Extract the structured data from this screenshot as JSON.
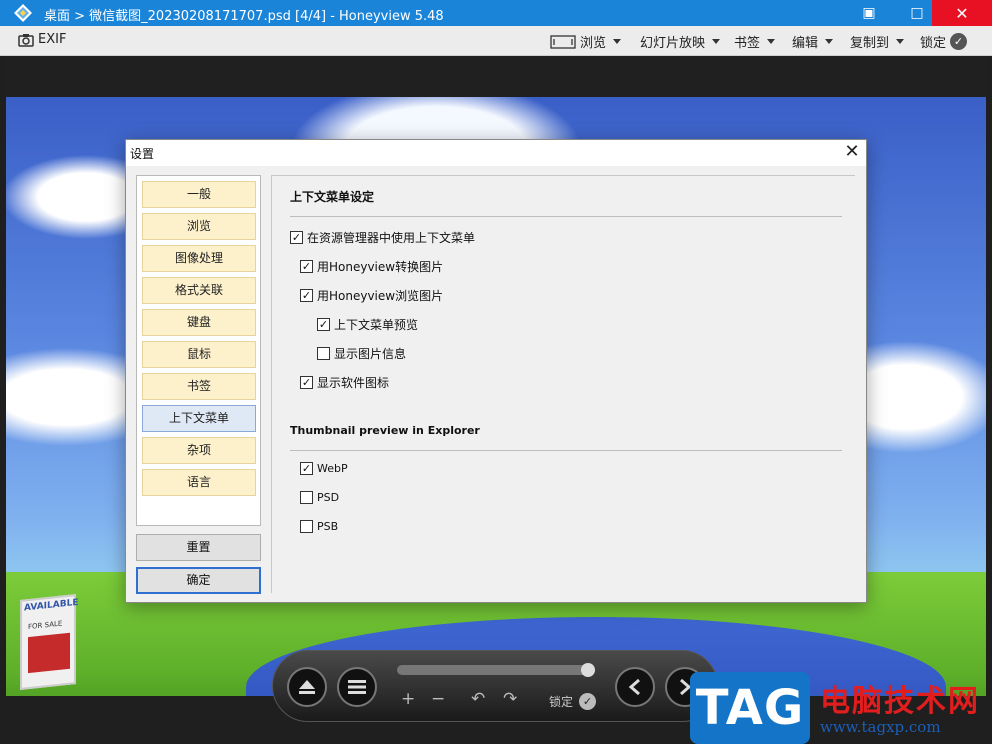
{
  "window": {
    "title": "桌面 > 微信截图_20230208171707.psd [4/4] - Honeyview 5.48",
    "minimize_glyph": "▣",
    "restore_glyph": "□",
    "close_glyph": "✕"
  },
  "toolbar": {
    "exif_label": "EXIF",
    "browse_label": "浏览",
    "slideshow_label": "幻灯片放映",
    "bookmarks_label": "书签",
    "edit_label": "编辑",
    "copy_to_label": "复制到",
    "lock_label": "锁定"
  },
  "image_sign": {
    "text": "AVAILABLE",
    "sub": "FOR SALE"
  },
  "dialog": {
    "title": "设置",
    "close_glyph": "✕",
    "nav_items": [
      {
        "label": "一般",
        "active": false
      },
      {
        "label": "浏览",
        "active": false
      },
      {
        "label": "图像处理",
        "active": false
      },
      {
        "label": "格式关联",
        "active": false
      },
      {
        "label": "键盘",
        "active": false
      },
      {
        "label": "鼠标",
        "active": false
      },
      {
        "label": "书签",
        "active": false
      },
      {
        "label": "上下文菜单",
        "active": true
      },
      {
        "label": "杂项",
        "active": false
      },
      {
        "label": "语言",
        "active": false
      }
    ],
    "reset_label": "重置",
    "ok_label": "确定",
    "section1_title": "上下文菜单设定",
    "options": [
      {
        "label": "在资源管理器中使用上下文菜单",
        "checked": true
      },
      {
        "label": "用Honeyview转换图片",
        "checked": true
      },
      {
        "label": "用Honeyview浏览图片",
        "checked": true
      },
      {
        "label": "上下文菜单预览",
        "checked": true
      },
      {
        "label": "显示图片信息",
        "checked": false
      },
      {
        "label": "显示软件图标",
        "checked": true
      }
    ],
    "section2_title": "Thumbnail preview in Explorer",
    "thumb_options": [
      {
        "label": "WebP",
        "checked": true
      },
      {
        "label": "PSD",
        "checked": false
      },
      {
        "label": "PSB",
        "checked": false
      }
    ]
  },
  "controls": {
    "lock_label": "锁定",
    "zoom_in": "+",
    "zoom_out": "−",
    "rotate_left": "↶",
    "rotate_right": "↷",
    "slider_value": 0.93
  },
  "watermark": {
    "tag": "TAG",
    "site_name": "电脑技术网",
    "url": "www.tagxp.com"
  }
}
